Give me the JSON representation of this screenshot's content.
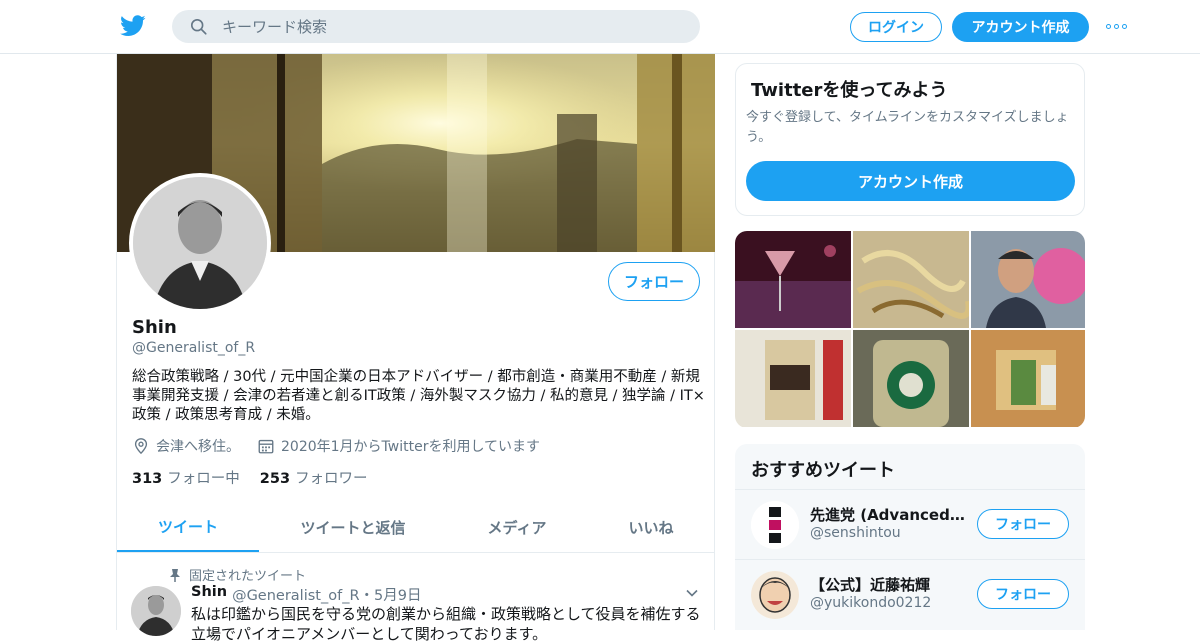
{
  "header": {
    "search_placeholder": "キーワード検索",
    "login_label": "ログイン",
    "signup_label": "アカウント作成"
  },
  "profile": {
    "name": "Shin",
    "handle": "@Generalist_of_R",
    "bio": "総合政策戦略 / 30代 / 元中国企業の日本アドバイザー / 都市創造・商業用不動産 / 新規事業開発支援 / 会津の若者達と創るIT政策 / 海外製マスク協力 / 私的意見 / 独学論 / IT×政策 / 政策思考育成 / 未婚。",
    "location": "会津へ移住。",
    "joined": "2020年1月からTwitterを利用しています",
    "following_count": "313",
    "following_label": "フォロー中",
    "followers_count": "253",
    "followers_label": "フォロワー",
    "follow_label": "フォロー"
  },
  "tabs": [
    {
      "label": "ツイート"
    },
    {
      "label": "ツイートと返信"
    },
    {
      "label": "メディア"
    },
    {
      "label": "いいね"
    }
  ],
  "pinned_tweet": {
    "pinned_label": "固定されたツイート",
    "author": "Shin",
    "handle_date": "@Generalist_of_R・5月9日",
    "text": "私は印鑑から国民を守る党の創業から組織・政策戦略として役員を補佐する立場でパイオニアメンバーとして関わっております。"
  },
  "signup_card": {
    "title": "Twitterを使ってみよう",
    "description": "今すぐ登録して、タイムラインをカスタマイズしましょう。",
    "button_label": "アカウント作成"
  },
  "recommended": {
    "title": "おすすめツイート",
    "items": [
      {
        "name": "先進党 (Advanced Pa…",
        "handle": "@senshintou",
        "button_label": "フォロー"
      },
      {
        "name": "【公式】近藤祐輝",
        "handle": "@yukikondo0212",
        "button_label": "フォロー"
      }
    ]
  },
  "colors": {
    "accent": "#1da1f2",
    "text_primary": "#14171a",
    "text_secondary": "#657786",
    "border": "#e6ecf0"
  }
}
